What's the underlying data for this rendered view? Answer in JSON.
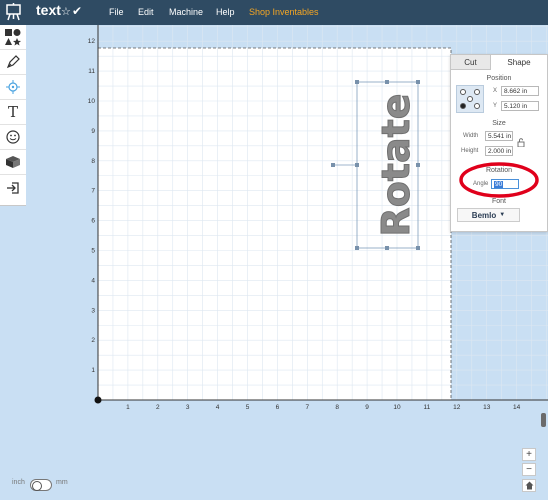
{
  "header": {
    "doc_title": "text",
    "menu": [
      "File",
      "Edit",
      "Machine",
      "Help",
      "Shop Inventables"
    ]
  },
  "toolbar": {
    "tools": [
      "shapes-icon",
      "pen-icon",
      "target-icon",
      "text-tool-icon",
      "emoji-icon",
      "box-icon",
      "import-icon"
    ],
    "text_tool_label": "T"
  },
  "canvas": {
    "x_ticks": [
      "1",
      "2",
      "3",
      "4",
      "5",
      "6",
      "7",
      "8",
      "9",
      "10",
      "11",
      "12",
      "13",
      "14"
    ],
    "y_ticks": [
      "12",
      "11",
      "10",
      "9",
      "8",
      "7",
      "6",
      "5",
      "4",
      "3",
      "2",
      "1"
    ],
    "selected_text": "Rotate"
  },
  "panel": {
    "tabs": [
      "Cut",
      "Shape"
    ],
    "position_title": "Position",
    "x_label": "X",
    "x_value": "8.662 in",
    "y_label": "Y",
    "y_value": "5.120 in",
    "size_title": "Size",
    "width_label": "Width",
    "width_value": "5.541 in",
    "height_label": "Height",
    "height_value": "2.000 in",
    "rotation_title": "Rotation",
    "angle_label": "Angle",
    "angle_value": "90",
    "font_title": "Font",
    "font_value": "Bemlo"
  },
  "footer": {
    "unit_left": "inch",
    "unit_right": "mm",
    "zoom_in": "+",
    "zoom_out": "−"
  },
  "colors": {
    "topbar": "#2f4b63",
    "accent": "#f5a623",
    "annotation": "#e0001b"
  }
}
